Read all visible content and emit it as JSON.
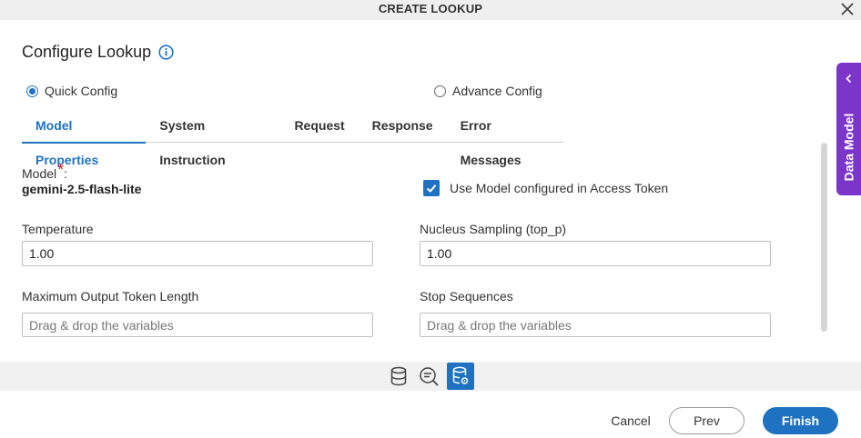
{
  "dialog": {
    "title": "CREATE LOOKUP",
    "heading": "Configure Lookup"
  },
  "config_mode": {
    "quick": "Quick Config",
    "advance": "Advance Config",
    "selected": "quick"
  },
  "tabs": [
    {
      "label": "Model Properties",
      "active": true
    },
    {
      "label": "System Instruction",
      "active": false
    },
    {
      "label": "Request",
      "active": false
    },
    {
      "label": "Response",
      "active": false
    },
    {
      "label": "Error Messages",
      "active": false
    }
  ],
  "form": {
    "model_label": "Model",
    "model_required": "*",
    "model_colon": ":",
    "model_value": "gemini-2.5-flash-lite",
    "use_model_label": "Use Model configured in Access Token",
    "use_model_checked": true,
    "temperature_label": "Temperature",
    "temperature_value": "1.00",
    "top_p_label": "Nucleus Sampling (top_p)",
    "top_p_value": "1.00",
    "max_tokens_label": "Maximum Output Token Length",
    "max_tokens_placeholder": "Drag & drop the variables",
    "stop_seq_label": "Stop Sequences",
    "stop_seq_placeholder": "Drag & drop the variables"
  },
  "side_panel": {
    "label": "Data Model"
  },
  "icons": {
    "close": "close-icon",
    "info": "info-icon",
    "database": "database-icon",
    "search_list": "search-list-icon",
    "database_settings": "database-settings-icon"
  },
  "footer": {
    "cancel": "Cancel",
    "prev": "Prev",
    "finish": "Finish"
  },
  "colors": {
    "accent": "#1f72c2",
    "side_panel": "#7b35c9",
    "required": "#c0232b"
  }
}
